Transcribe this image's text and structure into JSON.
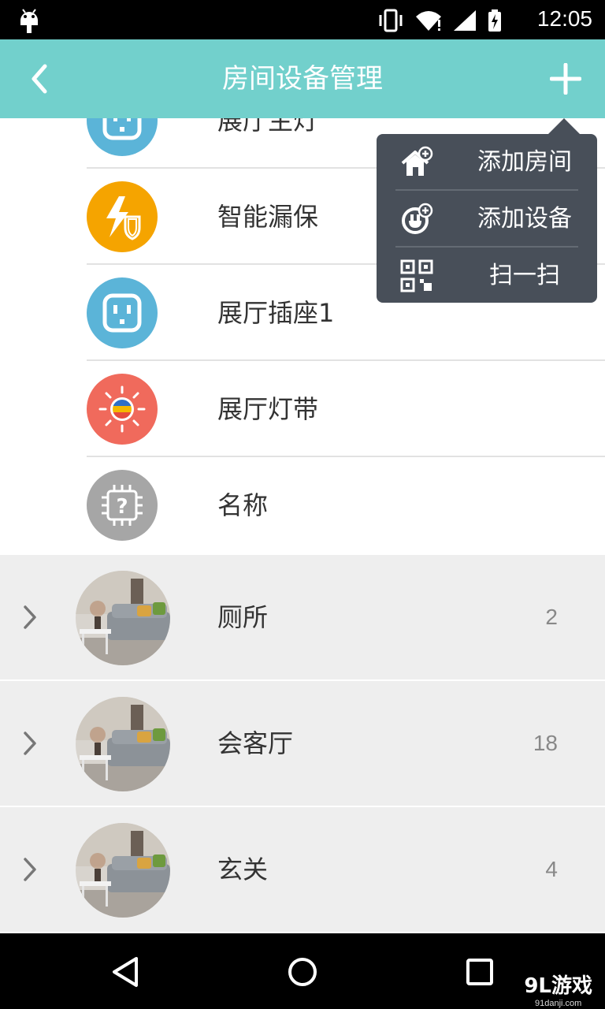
{
  "status_bar": {
    "time": "12:05",
    "icons": [
      "android-debug-icon",
      "vibrate-icon",
      "wifi-icon",
      "signal-icon",
      "battery-charging-icon"
    ]
  },
  "app_bar": {
    "title": "房间设备管理",
    "background": "#72d0cc",
    "back_icon": "chevron-left-icon",
    "add_icon": "plus-icon"
  },
  "devices": [
    {
      "name": "展厅主灯",
      "icon": "socket-icon",
      "color": "#5bb4d8"
    },
    {
      "name": "智能漏保",
      "icon": "leakage-protector-icon",
      "color": "#f5a400"
    },
    {
      "name": "展厅插座1",
      "icon": "socket-icon",
      "color": "#5bb4d8"
    },
    {
      "name": "展厅灯带",
      "icon": "light-strip-icon",
      "color": "#f06a5c"
    },
    {
      "name": "名称",
      "icon": "unknown-chip-icon",
      "color": "#a6a6a6"
    }
  ],
  "rooms": [
    {
      "name": "厕所",
      "count": "2"
    },
    {
      "name": "会客厅",
      "count": "18"
    },
    {
      "name": "玄关",
      "count": "4"
    }
  ],
  "popup_menu": {
    "items": [
      {
        "label": "添加房间",
        "icon": "add-room-icon"
      },
      {
        "label": "添加设备",
        "icon": "add-device-icon"
      },
      {
        "label": "扫一扫",
        "icon": "qr-scan-icon"
      }
    ],
    "background": "#484f59"
  },
  "nav_bar": {
    "buttons": [
      "back-triangle-icon",
      "home-circle-icon",
      "recents-square-icon"
    ]
  },
  "watermark": {
    "big": "9L游戏",
    "small": "91danji.com"
  }
}
